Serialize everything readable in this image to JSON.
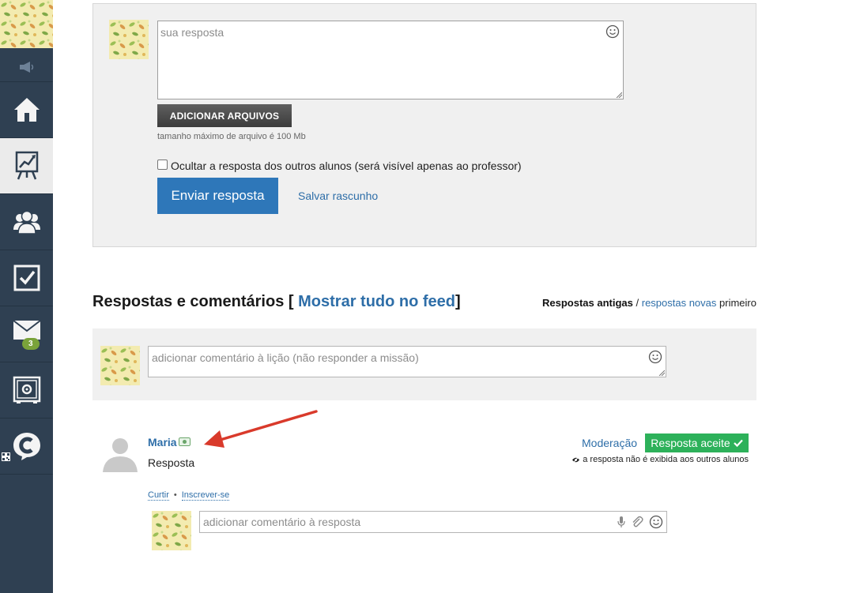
{
  "sidebar": {
    "items": [
      {
        "name": "home",
        "icon": "home-icon"
      },
      {
        "name": "lessons",
        "icon": "chart-board-icon",
        "active": true
      },
      {
        "name": "groups",
        "icon": "group-icon"
      },
      {
        "name": "tasks",
        "icon": "checkbox-icon"
      },
      {
        "name": "messages",
        "icon": "envelope-icon",
        "badge": "3"
      },
      {
        "name": "vault",
        "icon": "safe-icon"
      },
      {
        "name": "brand",
        "icon": "c-chat-icon"
      }
    ]
  },
  "answer_form": {
    "placeholder": "sua resposta",
    "add_files_label": "ADICIONAR ARQUIVOS",
    "file_size_note": "tamanho máximo de arquivo é 100 Mb",
    "hide_label": "Ocultar a resposta dos outros alunos (será visível apenas ao professor)",
    "send_label": "Enviar resposta",
    "draft_label": "Salvar rascunho"
  },
  "comments": {
    "title": "Respostas e comentários",
    "bracket_open": "[",
    "feed_link": "Mostrar tudo no feed",
    "bracket_close": "]",
    "sort_old": "Respostas antigas",
    "sort_sep": "/",
    "sort_new": "respostas novas",
    "sort_suffix": "primeiro",
    "lesson_comment_placeholder": "adicionar comentário à lição (não responder a missão)"
  },
  "answer_item": {
    "user_name": "Maria",
    "text": "Resposta",
    "moderation_label": "Moderação",
    "accepted_label": "Resposta aceite",
    "hidden_note": "a resposta não é exibida aos outros alunos",
    "like_label": "Curtir",
    "bullet": "•",
    "subscribe_label": "Inscrever-se",
    "reply_placeholder": "adicionar comentário à resposta"
  },
  "colors": {
    "sidebar": "#2f4052",
    "link": "#2e6ea8",
    "primary_button": "#2e77b9",
    "success": "#2db15a",
    "arrow": "#d93a2b"
  }
}
